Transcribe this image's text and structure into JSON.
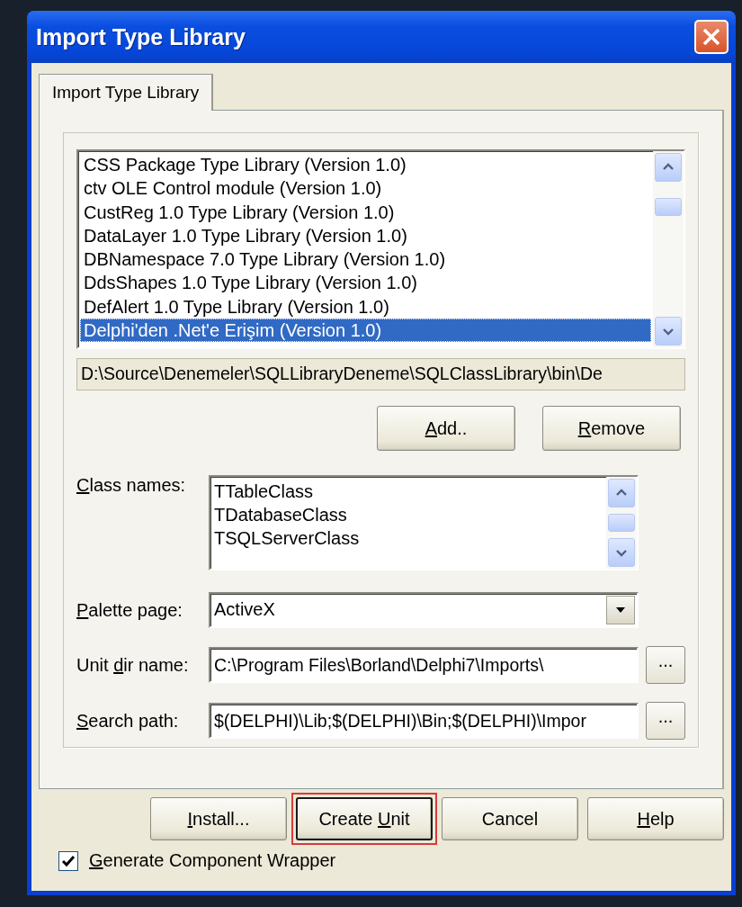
{
  "window": {
    "title": "Import Type Library"
  },
  "tabs": [
    {
      "label": "Import Type Library",
      "selected": true
    }
  ],
  "library_list": {
    "items": [
      {
        "label": "CSS Package Type Library (Version 1.0)",
        "selected": false
      },
      {
        "label": "ctv OLE Control module (Version 1.0)",
        "selected": false
      },
      {
        "label": "CustReg 1.0 Type Library (Version 1.0)",
        "selected": false
      },
      {
        "label": "DataLayer 1.0 Type Library (Version 1.0)",
        "selected": false
      },
      {
        "label": "DBNamespace 7.0 Type Library (Version 1.0)",
        "selected": false
      },
      {
        "label": "DdsShapes 1.0 Type Library (Version 1.0)",
        "selected": false
      },
      {
        "label": "DefAlert 1.0 Type Library (Version 1.0)",
        "selected": false
      },
      {
        "label": "Delphi'den .Net'e Erişim (Version 1.0)",
        "selected": true
      }
    ]
  },
  "library_path": "D:\\Source\\Denemeler\\SQLLibraryDeneme\\SQLClassLibrary\\bin\\De",
  "list_buttons": [
    {
      "key": "A",
      "post": "dd.."
    },
    {
      "key": "R",
      "post": "emove"
    }
  ],
  "class_names": {
    "label": {
      "key": "C",
      "post": "lass names:"
    },
    "items": [
      "TTableClass",
      "TDatabaseClass",
      "TSQLServerClass"
    ]
  },
  "palette_page": {
    "label": {
      "key": "P",
      "post": "alette page:"
    },
    "value": "ActiveX"
  },
  "unit_dir": {
    "label": {
      "pre": "Unit ",
      "key": "d",
      "post": "ir name:"
    },
    "value": "C:\\Program Files\\Borland\\Delphi7\\Imports\\",
    "browse": "..."
  },
  "search_path": {
    "label": {
      "key": "S",
      "post": "earch path:"
    },
    "value": "$(DELPHI)\\Lib;$(DELPHI)\\Bin;$(DELPHI)\\Impor",
    "browse": "..."
  },
  "buttons": [
    {
      "label": {
        "key": "I",
        "post": "nstall..."
      },
      "highlighted": false,
      "default": false
    },
    {
      "label": {
        "pre": "Create ",
        "key": "U",
        "post": "nit"
      },
      "highlighted": true,
      "default": true
    },
    {
      "label": {
        "pre": "Cancel"
      },
      "highlighted": false,
      "default": false
    },
    {
      "label": {
        "key": "H",
        "post": "elp"
      },
      "highlighted": false,
      "default": false
    }
  ],
  "generate_wrapper": {
    "label": {
      "key": "G",
      "post": "enerate Component Wrapper"
    },
    "checked": true
  }
}
